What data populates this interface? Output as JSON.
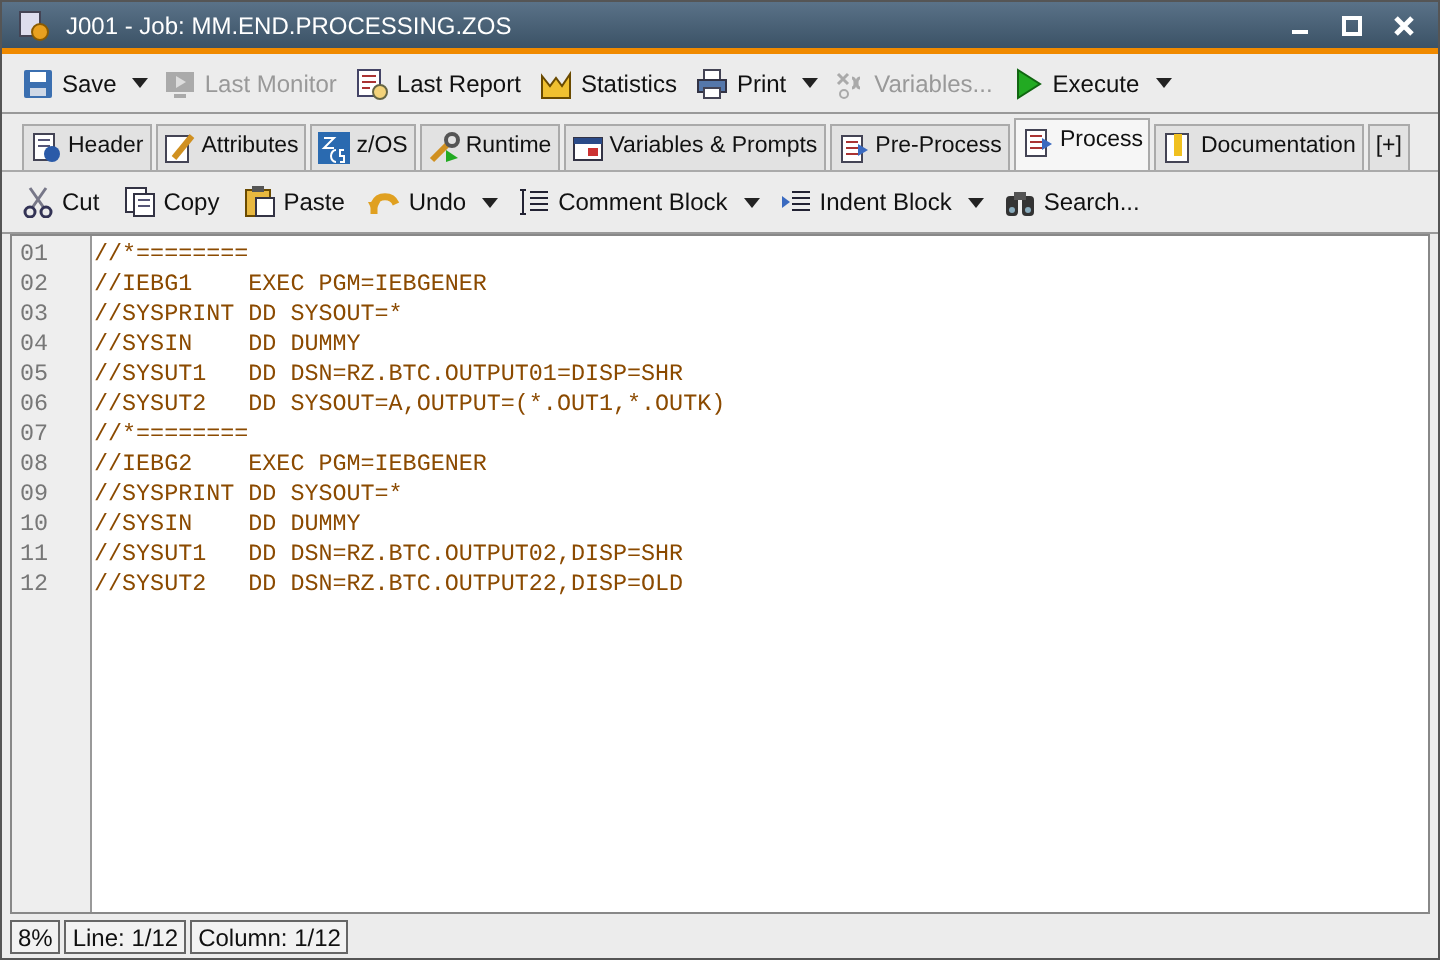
{
  "window": {
    "title": "J001 - Job: MM.END.PROCESSING.ZOS"
  },
  "toolbar": [
    {
      "label": "Save",
      "disabled": false,
      "dropdown": true
    },
    {
      "label": "Last Monitor",
      "disabled": true,
      "dropdown": false
    },
    {
      "label": "Last Report",
      "disabled": false,
      "dropdown": false
    },
    {
      "label": "Statistics",
      "disabled": false,
      "dropdown": false
    },
    {
      "label": "Print",
      "disabled": false,
      "dropdown": true
    },
    {
      "label": "Variables...",
      "disabled": true,
      "dropdown": false
    },
    {
      "label": "Execute",
      "disabled": false,
      "dropdown": true
    }
  ],
  "tabs": [
    {
      "label": "Header",
      "selected": false
    },
    {
      "label": "Attributes",
      "selected": false
    },
    {
      "label": "z/OS",
      "selected": false
    },
    {
      "label": "Runtime",
      "selected": false
    },
    {
      "label": "Variables & Prompts",
      "selected": false
    },
    {
      "label": "Pre-Process",
      "selected": false
    },
    {
      "label": "Process",
      "selected": true
    },
    {
      "label": "Documentation",
      "selected": false
    },
    {
      "label": "[+]",
      "selected": false
    }
  ],
  "edit_toolbar": [
    {
      "label": "Cut",
      "dropdown": false
    },
    {
      "label": "Copy",
      "dropdown": false
    },
    {
      "label": "Paste",
      "dropdown": false
    },
    {
      "label": "Undo",
      "dropdown": true
    },
    {
      "label": "Comment Block",
      "dropdown": true
    },
    {
      "label": "Indent Block",
      "dropdown": true
    },
    {
      "label": "Search...",
      "dropdown": false
    }
  ],
  "editor": {
    "lines": [
      {
        "number": "01",
        "text": "//*========"
      },
      {
        "number": "02",
        "text": "//IEBG1    EXEC PGM=IEBGENER"
      },
      {
        "number": "03",
        "text": "//SYSPRINT DD SYSOUT=*"
      },
      {
        "number": "04",
        "text": "//SYSIN    DD DUMMY"
      },
      {
        "number": "05",
        "text": "//SYSUT1   DD DSN=RZ.BTC.OUTPUT01=DISP=SHR"
      },
      {
        "number": "06",
        "text": "//SYSUT2   DD SYSOUT=A,OUTPUT=(*.OUT1,*.OUTK)"
      },
      {
        "number": "07",
        "text": "//*========"
      },
      {
        "number": "08",
        "text": "//IEBG2    EXEC PGM=IEBGENER"
      },
      {
        "number": "09",
        "text": "//SYSPRINT DD SYSOUT=*"
      },
      {
        "number": "10",
        "text": "//SYSIN    DD DUMMY"
      },
      {
        "number": "11",
        "text": "//SYSUT1   DD DSN=RZ.BTC.OUTPUT02,DISP=SHR"
      },
      {
        "number": "12",
        "text": "//SYSUT2   DD DSN=RZ.BTC.OUTPUT22,DISP=OLD"
      }
    ]
  },
  "status_bar": [
    "8%",
    "Line: 1/12",
    "Column: 1/12"
  ]
}
